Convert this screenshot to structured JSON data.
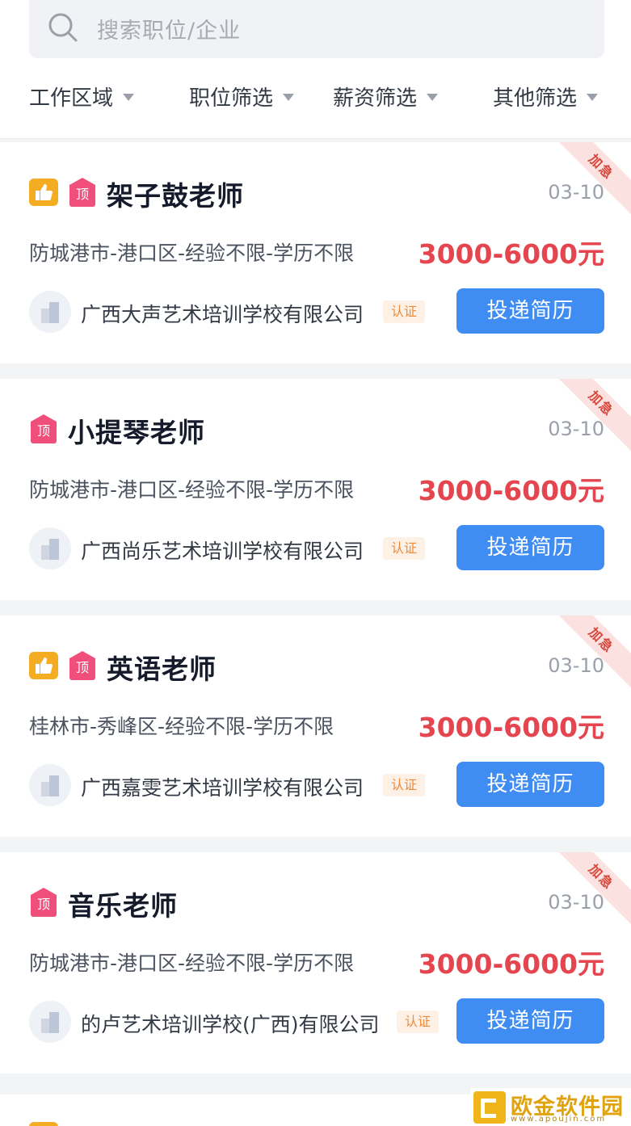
{
  "search": {
    "placeholder": "搜索职位/企业"
  },
  "filters": [
    "工作区域",
    "职位筛选",
    "薪资筛选",
    "其他筛选"
  ],
  "ribbon_label": "加急",
  "apply_label": "投递简历",
  "verified_label": "认证",
  "top_badge_label": "顶",
  "jobs": [
    {
      "title": "架子鼓老师",
      "date": "03-10",
      "location": "防城港市-港口区-经验不限-学历不限",
      "salary": "3000-6000元",
      "company": "广西大声艺术培训学校有限公司",
      "thumb": true
    },
    {
      "title": "小提琴老师",
      "date": "03-10",
      "location": "防城港市-港口区-经验不限-学历不限",
      "salary": "3000-6000元",
      "company": "广西尚乐艺术培训学校有限公司",
      "thumb": false
    },
    {
      "title": "英语老师",
      "date": "03-10",
      "location": "桂林市-秀峰区-经验不限-学历不限",
      "salary": "3000-6000元",
      "company": "广西嘉雯艺术培训学校有限公司",
      "thumb": true
    },
    {
      "title": "音乐老师",
      "date": "03-10",
      "location": "防城港市-港口区-经验不限-学历不限",
      "salary": "3000-6000元",
      "company": "的卢艺术培训学校(广西)有限公司",
      "thumb": false
    }
  ],
  "watermark": {
    "text": "欧金软件园",
    "url": "www.apoujin.com"
  }
}
